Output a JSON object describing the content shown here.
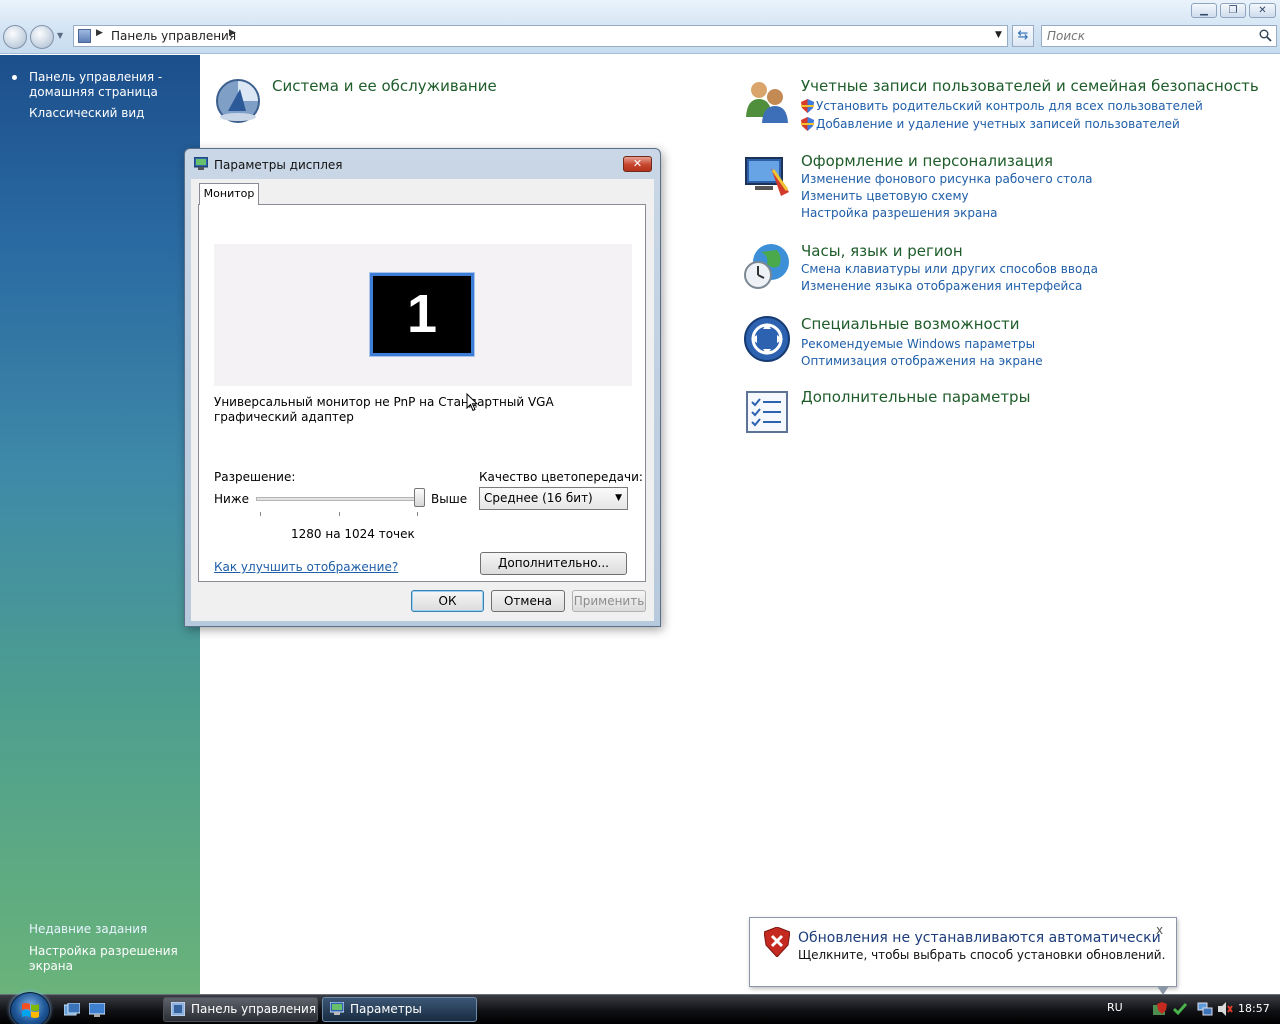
{
  "address_bar": {
    "path": "Панель управления",
    "search_placeholder": "Поиск"
  },
  "left_panel": {
    "home_link": "Панель управления - домашняя страница",
    "classic_view": "Классический вид",
    "recent_tasks_title": "Недавние задания",
    "recent_tasks_item": "Настройка разрешения экрана"
  },
  "categories": [
    {
      "title": "Система и ее обслуживание",
      "icon": "system-maintenance-icon",
      "links": []
    },
    {
      "title": "Учетные записи пользователей и семейная безопасность",
      "icon": "user-accounts-icon",
      "links": [
        "Установить родительский контроль для всех пользователей",
        "Добавление и удаление учетных записей пользователей"
      ]
    },
    {
      "title": "Оформление и персонализация",
      "icon": "appearance-icon",
      "links": [
        "Изменение фонового рисунка рабочего стола",
        "Изменить цветовую схему",
        "Настройка разрешения экрана"
      ]
    },
    {
      "title": "Часы, язык и регион",
      "icon": "clock-globe-icon",
      "links": [
        "Смена клавиатуры или других способов ввода",
        "Изменение языка отображения интерфейса"
      ]
    },
    {
      "title": "Специальные возможности",
      "icon": "ease-of-access-icon",
      "links": [
        "Рекомендуемые Windows параметры",
        "Оптимизация отображения на экране"
      ]
    },
    {
      "title": "Дополнительные параметры",
      "icon": "additional-options-icon",
      "links": []
    }
  ],
  "dialog": {
    "title": "Параметры дисплея",
    "tab": "Монитор",
    "monitor_number": "1",
    "monitor_description": "Универсальный монитор не PnP на Стандартный VGA графический адаптер",
    "resolution_label": "Разрешение:",
    "slider_low": "Ниже",
    "slider_high": "Выше",
    "resolution_value": "1280 на 1024 точек",
    "resolution_slider_position": 1.0,
    "color_quality_label": "Качество цветопередачи:",
    "color_quality_value": "Среднее (16 бит)",
    "help_link": "Как улучшить отображение?",
    "advanced_button": "Дополнительно...",
    "ok_button": "ОК",
    "cancel_button": "Отмена",
    "apply_button": "Применить"
  },
  "notification": {
    "title": "Обновления не устанавливаются автоматически",
    "text": "Щелкните, чтобы выбрать способ установки обновлений.",
    "close": "x"
  },
  "taskbar": {
    "tasks": [
      "Панель управления",
      "Параметры дисплея"
    ],
    "language": "RU",
    "clock": "18:57"
  }
}
